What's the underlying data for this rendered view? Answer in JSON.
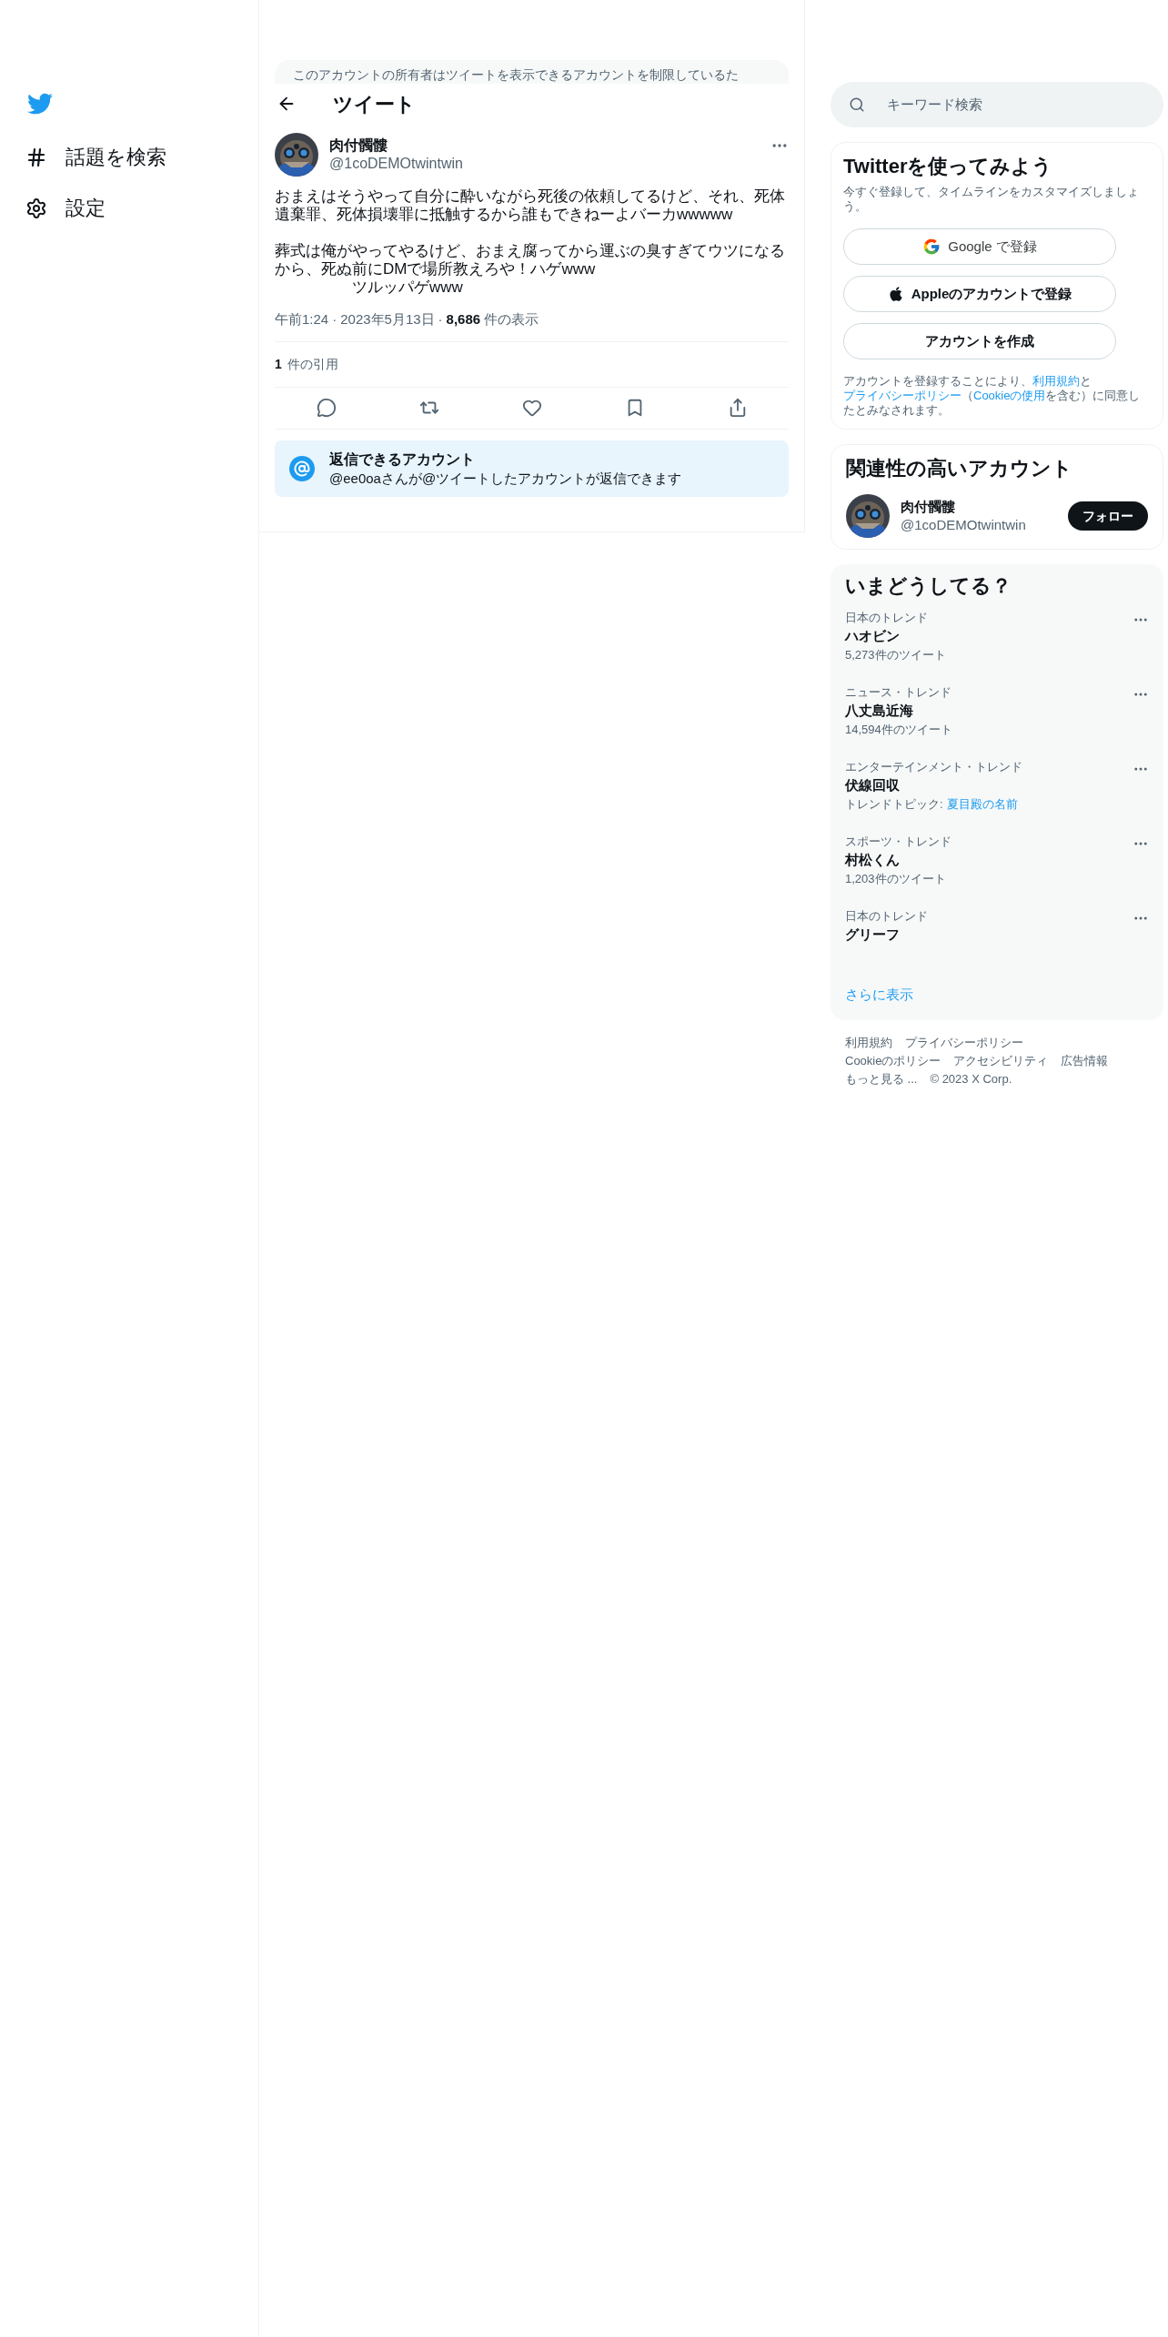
{
  "sidebar": {
    "items": [
      {
        "kind": "hashtag",
        "label": "話題を検索"
      },
      {
        "kind": "settings",
        "label": "設定"
      }
    ]
  },
  "main": {
    "notice": "このアカウントの所有者はツイートを表示できるアカウントを制限しているた",
    "header": {
      "title": "ツイート"
    },
    "tweet": {
      "name": "肉付髑髏",
      "handle": "@1coDEMOtwintwin",
      "paragraphs": [
        "おまえはそうやって自分に酔いながら死後の依頼してるけど、それ、死体遺棄罪、死体損壊罪に抵触するから誰もできねーよバーカwwwww",
        "葬式は俺がやってやるけど、おまえ腐ってから運ぶの臭すぎてウツになるから、死ぬ前にDMで場所教えろや！ハゲwww\n　　　　　ツルッパゲwww"
      ],
      "time": "午前1:24",
      "separator": "·",
      "date": "2023年5月13日",
      "views_count": "8,686",
      "views_label": "件の表示",
      "quotes_count": "1",
      "quotes_label": "件の引用"
    },
    "reply_restriction": {
      "title": "返信できるアカウント",
      "text": "@ee0oaさんが@ツイートしたアカウントが返信できます"
    }
  },
  "right": {
    "search": {
      "placeholder": "キーワード検索"
    },
    "signup": {
      "title": "Twitterを使ってみよう",
      "subtitle": "今すぐ登録して、タイムラインをカスタマイズしましょう。",
      "buttons": [
        {
          "kind": "google",
          "label": "Google で登録"
        },
        {
          "kind": "apple",
          "label": "Appleのアカウントで登録"
        },
        {
          "kind": "plain",
          "label": "アカウントを作成"
        }
      ],
      "legal": [
        {
          "text": "アカウントを登録することにより、",
          "link": false
        },
        {
          "text": "利用規約",
          "link": true
        },
        {
          "text": "と",
          "link": false
        },
        {
          "text": "プライバシーポリシー",
          "link": true
        },
        {
          "text": "（",
          "link": false
        },
        {
          "text": "Cookieの使用",
          "link": true
        },
        {
          "text": "を含む）に同意したとみなされます。",
          "link": false
        }
      ]
    },
    "relevant": {
      "title": "関連性の高いアカウント",
      "name": "肉付髑髏",
      "handle": "@1coDEMOtwintwin",
      "follow_label": "フォロー"
    },
    "trends": {
      "title": "いまどうしてる？",
      "items": [
        {
          "category": "日本のトレンド",
          "name": "ハオビン",
          "count": "5,273件のツイート"
        },
        {
          "category": "ニュース・トレンド",
          "name": "八丈島近海",
          "count": "14,594件のツイート"
        },
        {
          "category": "エンターテインメント・トレンド",
          "name": "伏線回収",
          "topic_label": "トレンドトピック:",
          "topic_link": "夏目殿の名前"
        },
        {
          "category": "スポーツ・トレンド",
          "name": "村松くん",
          "count": "1,203件のツイート"
        },
        {
          "category": "日本のトレンド",
          "name": "グリーフ"
        }
      ],
      "show_more": "さらに表示"
    },
    "footer": {
      "links": [
        "利用規約",
        "プライバシーポリシー",
        "Cookieのポリシー",
        "アクセシビリティ",
        "広告情報",
        "もっと見る ..."
      ],
      "copyright": "© 2023 X Corp."
    }
  }
}
